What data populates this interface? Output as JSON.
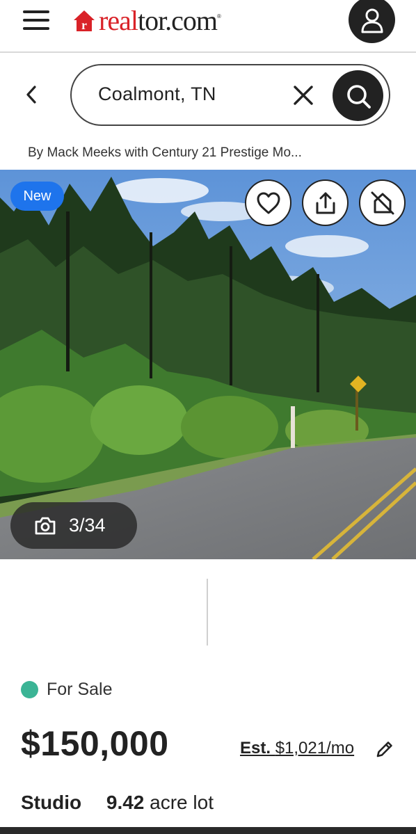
{
  "header": {
    "logo": {
      "brand_part": "real",
      "rest_part": "tor.com",
      "registered": "®"
    },
    "menu_icon": "hamburger-menu-icon",
    "account_icon": "user-icon",
    "brand_color": "#d92228"
  },
  "search": {
    "value": "Coalmont, TN",
    "back_icon": "chevron-left-icon",
    "clear_icon": "close-icon",
    "search_icon": "search-icon"
  },
  "listing": {
    "byline": "By Mack Meeks with Century 21 Prestige Mo...",
    "badge": "New",
    "photo_counter": "3/34",
    "actions": [
      "heart-icon",
      "share-icon",
      "hide-icon"
    ],
    "status": "For Sale",
    "status_color": "#3bb495",
    "price": "$150,000",
    "est_label": "Est.",
    "est_value": "$1,021/mo",
    "beds": "Studio",
    "lot_size": "9.42",
    "lot_label": "acre lot"
  }
}
